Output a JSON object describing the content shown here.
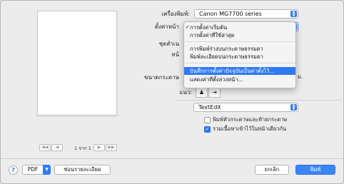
{
  "printer": {
    "label": "เครื่องพิมพ์:",
    "value": "Canon MG7700 series"
  },
  "presets": {
    "label_partial": "ชุดสำเน",
    "label_partial2": "หน้"
  },
  "page_setup": {
    "label": "ตั้งค่าหน้า"
  },
  "paper_size": {
    "label_partial": "ขนาดกระดาษ",
    "suffix": "ม."
  },
  "orientation": {
    "label": "แนว:"
  },
  "menu": {
    "items": [
      {
        "label": "การตั้งค่าเริ่มต้น",
        "checked": true
      },
      {
        "label": "การตั้งค่าที่ใช้ล่าสุด"
      },
      {
        "label": "การพิมพ์ร่างบนกระดาษธรรมดา"
      },
      {
        "label": "พิมพ์ละเอียดบนกระดาษธรรมดา"
      },
      {
        "label": "บันทึกการตั้งค่าปัจจุบันเป็นค่าตั้งไว้...",
        "selected": true
      },
      {
        "label": "แสดงค่าที่ตั้งล่วงหน้า..."
      }
    ]
  },
  "app_section": {
    "value": "TextEdit"
  },
  "options": [
    {
      "label": "พิมพ์หัวกระดาษและท้ายกระดาษ",
      "checked": false
    },
    {
      "label": "รวมเนื้อหาเข้าไว้ในหน้าเดียวกัน",
      "checked": true
    }
  ],
  "preview": {
    "page_indicator": "1 จาก 1",
    "nav": [
      "◀◀",
      "◀",
      "▶",
      "▶▶"
    ]
  },
  "bottom": {
    "help": "?",
    "pdf": "PDF",
    "show_details": "ซ่อนรายละเอียด",
    "cancel": "ยกเลิก",
    "print": "พิมพ์"
  },
  "colors": {
    "accent": "#2f79f2"
  }
}
